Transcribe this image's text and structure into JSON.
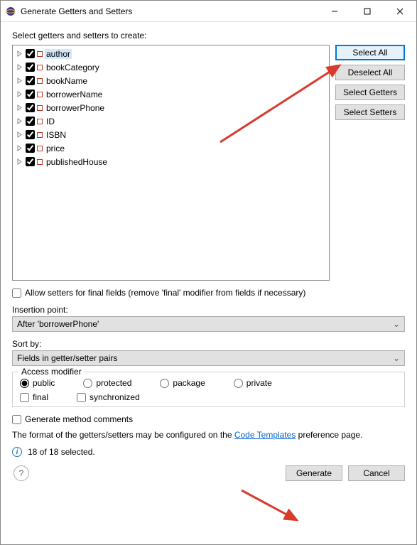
{
  "titlebar": {
    "title": "Generate Getters and Setters"
  },
  "instruction": "Select getters and setters to create:",
  "fields": [
    "author",
    "bookCategory",
    "bookName",
    "borrowerName",
    "borrowerPhone",
    "ID",
    "ISBN",
    "price",
    "publishedHouse"
  ],
  "buttons": {
    "select_all": "Select All",
    "deselect_all": "Deselect All",
    "select_getters": "Select Getters",
    "select_setters": "Select Setters"
  },
  "allow_final": "Allow setters for final fields (remove 'final' modifier from fields if necessary)",
  "insertion_label": "Insertion point:",
  "insertion_value": "After 'borrowerPhone'",
  "sortby_label": "Sort by:",
  "sortby_value": "Fields in getter/setter pairs",
  "access": {
    "legend": "Access modifier",
    "public": "public",
    "protected": "protected",
    "package": "package",
    "private": "private",
    "final": "final",
    "synchronized": "synchronized"
  },
  "gen_comments": "Generate method comments",
  "format_pre": "The format of the getters/setters may be configured on the ",
  "format_link": "Code Templates",
  "format_post": " preference page.",
  "status": "18 of 18 selected.",
  "footer": {
    "generate": "Generate",
    "cancel": "Cancel"
  }
}
